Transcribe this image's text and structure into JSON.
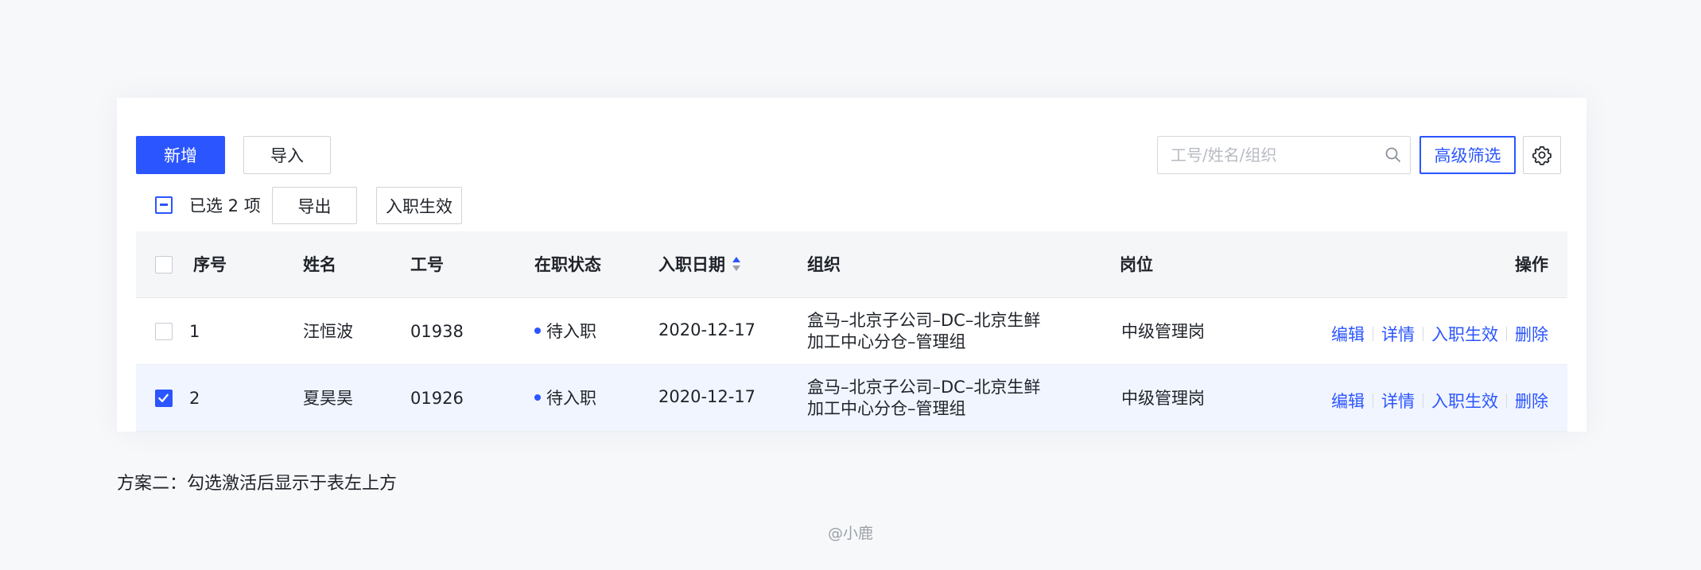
{
  "colors": {
    "primary": "#2b55ff",
    "status_dot": "#2b55ff",
    "selected_row_bg": "#f1f5ff",
    "header_bg": "#f5f6f8",
    "page_bg": "#f7f8fa"
  },
  "toolbar": {
    "add_label": "新增",
    "import_label": "导入",
    "search_placeholder": "工号/姓名/组织",
    "advanced_filter_label": "高级筛选",
    "settings_icon": "gear-icon",
    "search_icon": "search-icon"
  },
  "selection_bar": {
    "selected_text": "已选 2 项",
    "export_label": "导出",
    "activate_label": "入职生效"
  },
  "table": {
    "columns": {
      "index": "序号",
      "name": "姓名",
      "id": "工号",
      "status": "在职状态",
      "date": "入职日期",
      "org": "组织",
      "position": "岗位",
      "ops": "操作"
    },
    "sort_column": "date",
    "rows": [
      {
        "checked": false,
        "index": "1",
        "name": "汪恒波",
        "id": "01938",
        "status": "待入职",
        "date": "2020-12-17",
        "org_line1": "盒马–北京子公司–DC–北京生鲜",
        "org_line2": "加工中心分仓–管理组",
        "position": "中级管理岗",
        "ops": [
          "编辑",
          "详情",
          "入职生效",
          "删除"
        ]
      },
      {
        "checked": true,
        "index": "2",
        "name": "夏昊昊",
        "id": "01926",
        "status": "待入职",
        "date": "2020-12-17",
        "org_line1": "盒马–北京子公司–DC–北京生鲜",
        "org_line2": "加工中心分仓–管理组",
        "position": "中级管理岗",
        "ops": [
          "编辑",
          "详情",
          "入职生效",
          "删除"
        ]
      }
    ]
  },
  "caption": "方案二：勾选激活后显示于表左上方",
  "footer": "@小鹿"
}
